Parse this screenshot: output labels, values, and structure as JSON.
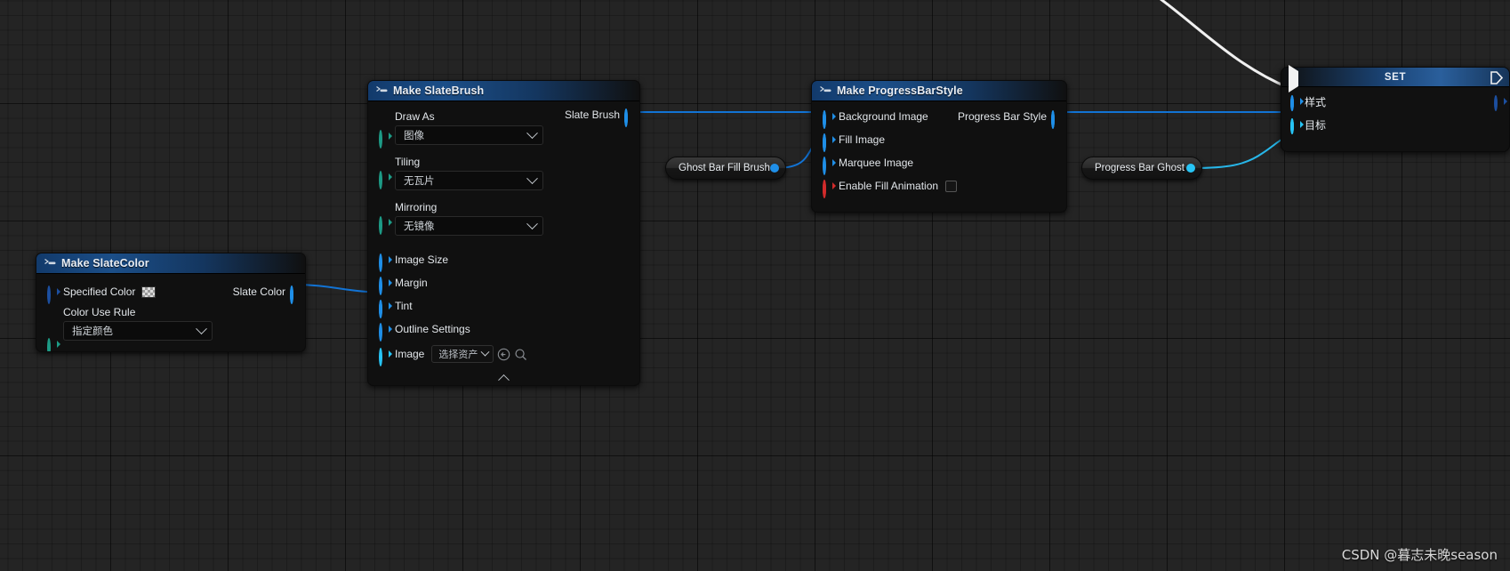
{
  "app": {
    "kind": "unreal-blueprint-graph",
    "background_color": "#242424",
    "grid_color": "#000000",
    "watermark": "CSDN @暮志未晚season"
  },
  "nodes": {
    "make_slate_color": {
      "title": "Make SlateColor",
      "icon": "make-struct-icon",
      "inputs": [
        {
          "label": "Specified Color",
          "pin": "struct",
          "filled": false,
          "swatch": "transparent-checker"
        }
      ],
      "outputs": [
        {
          "label": "Slate Color",
          "pin": "struct",
          "filled": true
        }
      ],
      "fields": [
        {
          "label": "Color Use Rule",
          "value": "指定颜色",
          "pin": "enum",
          "control": "dropdown"
        }
      ]
    },
    "make_slate_brush": {
      "title": "Make SlateBrush",
      "icon": "make-struct-icon",
      "outputs": [
        {
          "label": "Slate Brush",
          "pin": "struct",
          "filled": true
        }
      ],
      "fields": [
        {
          "label": "Draw As",
          "value": "图像",
          "pin": "enum",
          "control": "dropdown"
        },
        {
          "label": "Tiling",
          "value": "无瓦片",
          "pin": "enum",
          "control": "dropdown"
        },
        {
          "label": "Mirroring",
          "value": "无镜像",
          "pin": "enum",
          "control": "dropdown"
        }
      ],
      "inputs": [
        {
          "label": "Image Size",
          "pin": "struct",
          "filled": false
        },
        {
          "label": "Margin",
          "pin": "struct",
          "filled": false
        },
        {
          "label": "Tint",
          "pin": "struct",
          "filled": true
        },
        {
          "label": "Outline Settings",
          "pin": "struct",
          "filled": false
        },
        {
          "label": "Image",
          "pin": "object",
          "filled": false,
          "control": "asset-picker",
          "asset_value": "选择资产"
        }
      ],
      "collapse_icon": "chevron-up-icon"
    },
    "make_progress_bar_style": {
      "title": "Make ProgressBarStyle",
      "icon": "make-struct-icon",
      "inputs": [
        {
          "label": "Background Image",
          "pin": "struct",
          "filled": true
        },
        {
          "label": "Fill Image",
          "pin": "struct",
          "filled": true
        },
        {
          "label": "Marquee Image",
          "pin": "struct",
          "filled": false
        },
        {
          "label": "Enable Fill Animation",
          "pin": "bool",
          "filled": true,
          "control": "checkbox",
          "checked": false
        }
      ],
      "outputs": [
        {
          "label": "Progress Bar Style",
          "pin": "struct",
          "filled": true
        }
      ]
    },
    "set_node": {
      "title": "SET",
      "exec_in": "exec-in-pin",
      "exec_out": "exec-out-pin",
      "inputs": [
        {
          "label": "样式",
          "pin": "struct",
          "filled": true
        },
        {
          "label": "目标",
          "pin": "object",
          "filled": true
        }
      ],
      "outputs": [
        {
          "label": "",
          "pin": "struct",
          "filled": false
        }
      ]
    }
  },
  "reroutes": [
    {
      "label": "Ghost Bar Fill Brush",
      "pin_color": "#1f8fe8"
    },
    {
      "label": "Progress Bar Ghost",
      "pin_color": "#27c4f5"
    }
  ],
  "colors": {
    "pin_struct_blue": "#1f8fe8",
    "pin_object_cyan": "#27c4f5",
    "pin_enum_teal": "#1d9b86",
    "pin_bool_red": "#d22b2b",
    "wire_blue": "#1273d4",
    "wire_cyan": "#27b6e8",
    "wire_exec_white": "#f0f0f0",
    "node_header_blue": "#1b4e88"
  }
}
